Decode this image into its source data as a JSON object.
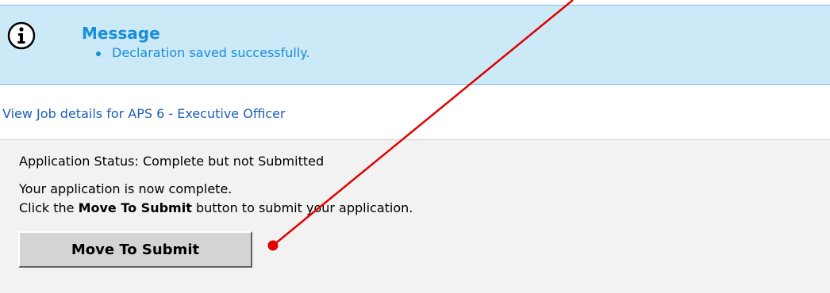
{
  "message": {
    "icon": "info-icon",
    "title": "Message",
    "items": [
      "Declaration saved successfully."
    ]
  },
  "job_link": {
    "label": "View Job details for APS 6 - Executive Officer"
  },
  "application": {
    "status_text": "Application Status: Complete but not Submitted",
    "complete_text": "Your application is now complete.",
    "instruction_prefix": "Click the ",
    "instruction_bold": "Move To Submit",
    "instruction_suffix": " button to submit your application.",
    "submit_label": "Move To Submit"
  },
  "colors": {
    "message_background": "#cbe9f7",
    "message_text": "#1a8fd6",
    "link": "#1a5fb4",
    "panel_background": "#f2f2f2",
    "annotation": "#e00000"
  }
}
